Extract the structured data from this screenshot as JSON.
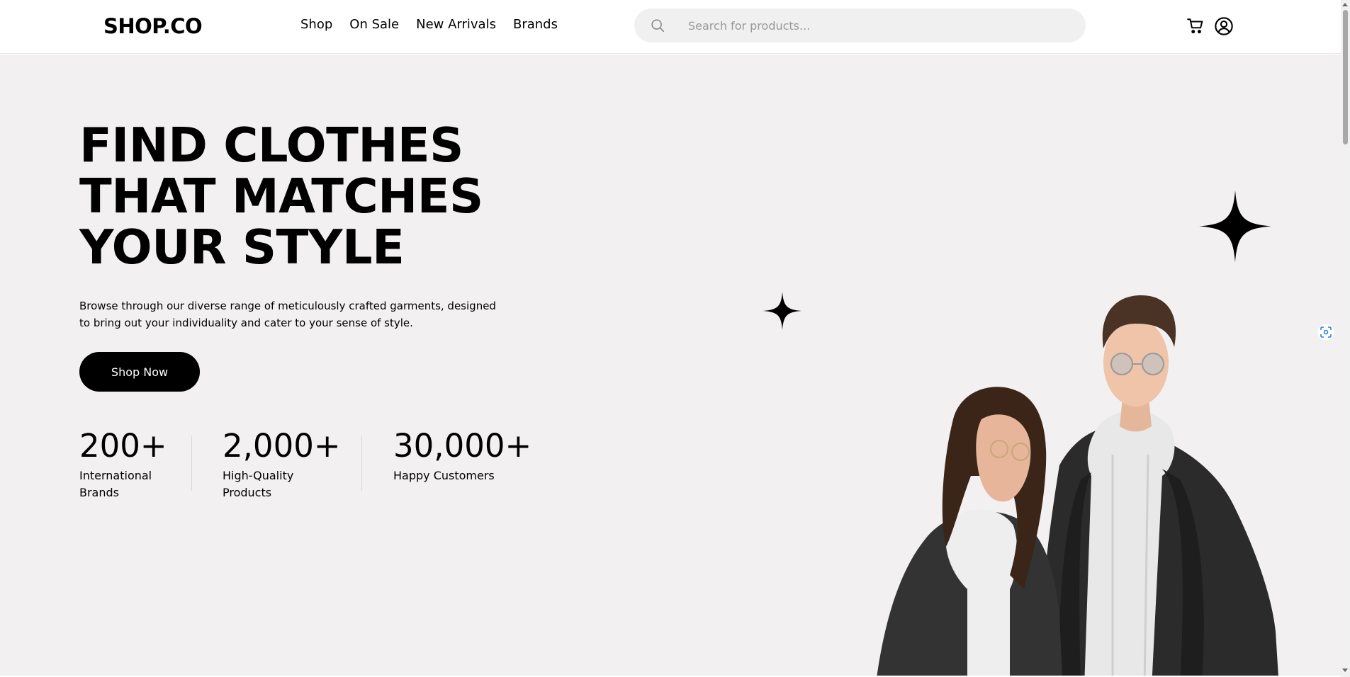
{
  "header": {
    "logo": "SHOP.CO",
    "nav": [
      "Shop",
      "On Sale",
      "New Arrivals",
      "Brands"
    ],
    "search": {
      "placeholder": "Search for products..."
    },
    "icons": [
      "cart-icon",
      "user-icon"
    ]
  },
  "hero": {
    "headline": [
      "FIND CLOTHES",
      "THAT MATCHES",
      "YOUR STYLE"
    ],
    "subtext": "Browse through our diverse range of meticulously crafted garments, designed to bring out your individuality and cater to your sense of style.",
    "button_label": "Shop Now",
    "stats": [
      {
        "value": "200+",
        "label": "International Brands"
      },
      {
        "value": "2,000+",
        "label": "High-Quality Products"
      },
      {
        "value": "30,000+",
        "label": "Happy Customers"
      }
    ]
  },
  "colors": {
    "accent": "#000000",
    "hero_bg": "#f2f0f1",
    "search_bg": "#f0f0f0"
  }
}
